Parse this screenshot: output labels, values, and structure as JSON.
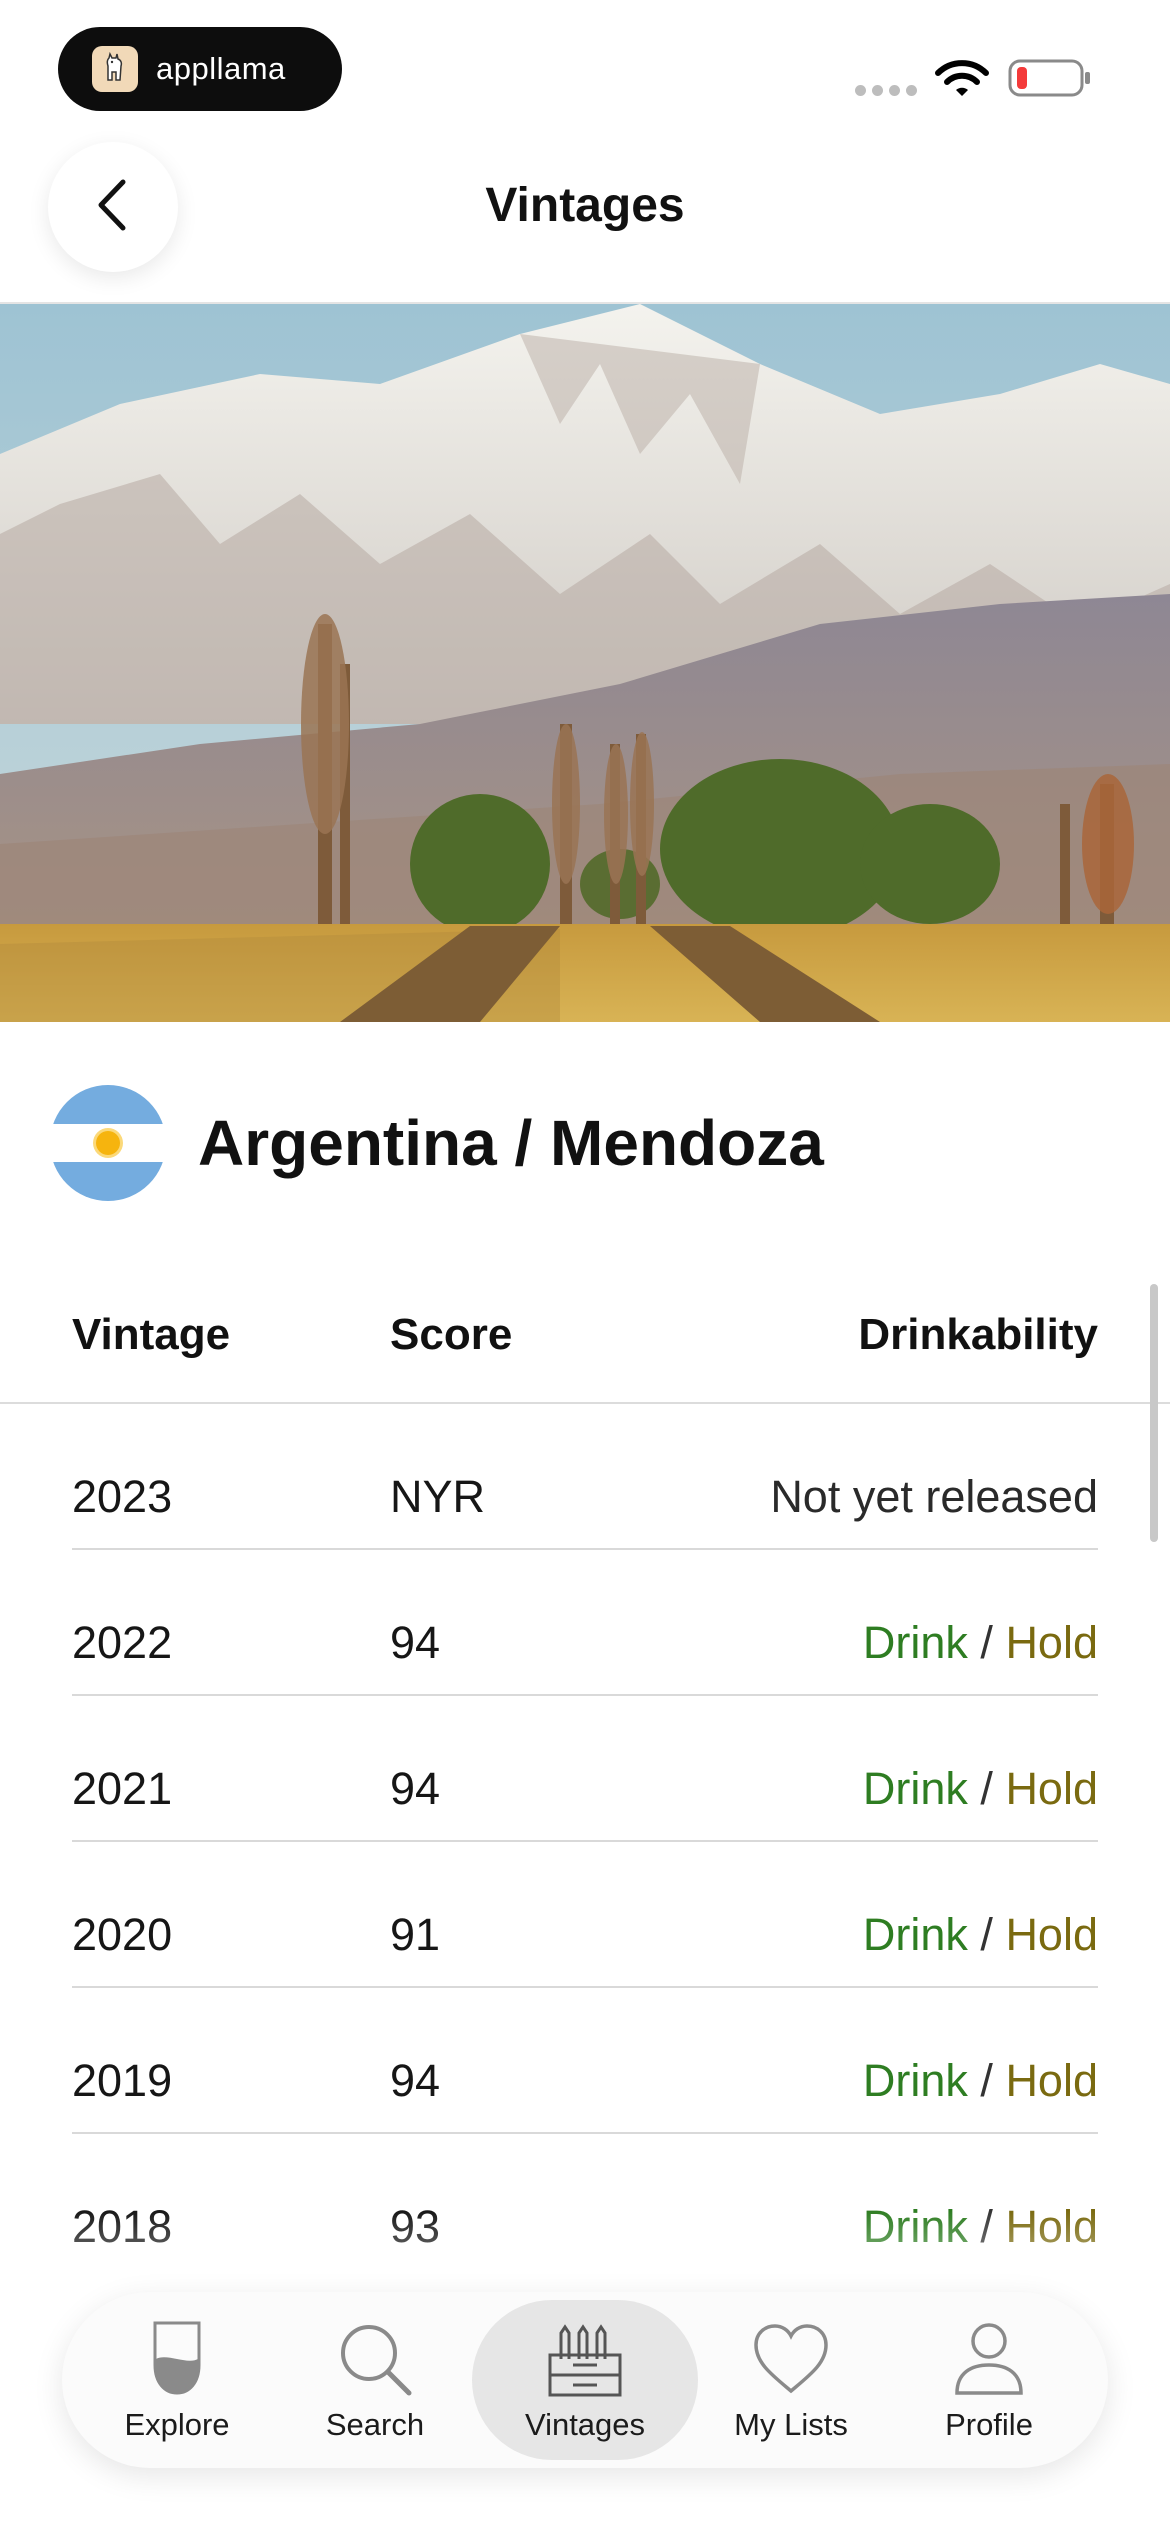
{
  "status_bar": {
    "brand": "appllama",
    "icons": [
      "llama-logo-icon",
      "signal-icon",
      "wifi-icon",
      "battery-low-icon"
    ]
  },
  "header": {
    "title": "Vintages",
    "back_icon": "chevron-left-icon"
  },
  "region": {
    "title": "Argentina / Mendoza",
    "flag_icon": "argentina-flag-icon"
  },
  "table": {
    "columns": [
      "Vintage",
      "Score",
      "Drinkability"
    ],
    "rows": [
      {
        "vintage": "2023",
        "score": "NYR",
        "note": "Not yet released"
      },
      {
        "vintage": "2022",
        "score": "94",
        "drink": "Drink",
        "sep": "/",
        "hold": "Hold"
      },
      {
        "vintage": "2021",
        "score": "94",
        "drink": "Drink",
        "sep": "/",
        "hold": "Hold"
      },
      {
        "vintage": "2020",
        "score": "91",
        "drink": "Drink",
        "sep": "/",
        "hold": "Hold"
      },
      {
        "vintage": "2019",
        "score": "94",
        "drink": "Drink",
        "sep": "/",
        "hold": "Hold"
      },
      {
        "vintage": "2018",
        "score": "93",
        "drink": "Drink",
        "sep": "/",
        "hold": "Hold"
      }
    ]
  },
  "colors": {
    "drink": "#2e7d22",
    "hold": "#7a6a10",
    "flag_blue": "#74acdf",
    "flag_sun": "#f6b40e"
  },
  "tabs": [
    {
      "label": "Explore",
      "icon": "wine-glass-icon",
      "active": false
    },
    {
      "label": "Search",
      "icon": "search-icon",
      "active": false
    },
    {
      "label": "Vintages",
      "icon": "wine-crate-icon",
      "active": true
    },
    {
      "label": "My Lists",
      "icon": "heart-icon",
      "active": false
    },
    {
      "label": "Profile",
      "icon": "user-icon",
      "active": false
    }
  ]
}
